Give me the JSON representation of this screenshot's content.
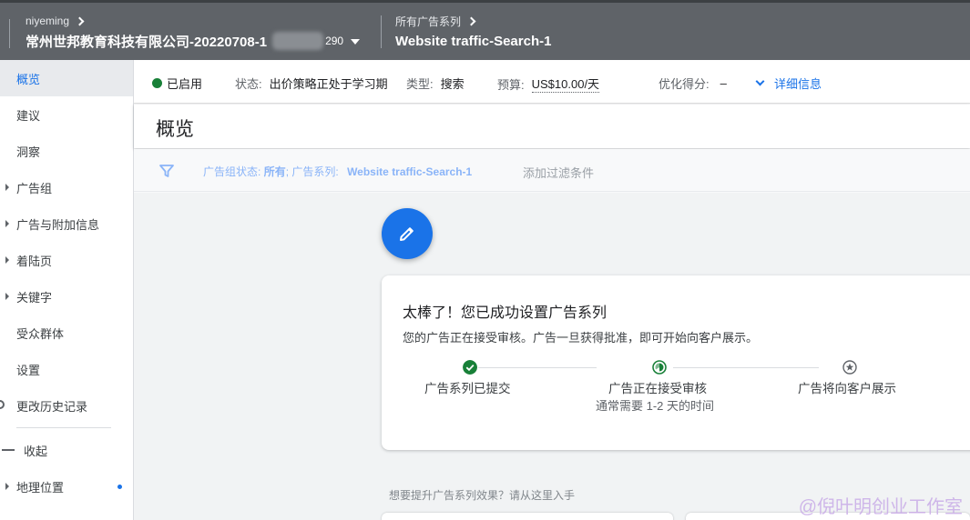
{
  "header": {
    "account_user": "niyeming",
    "account_name": "常州世邦教育科技有限公司-20220708-1",
    "account_id_tail": "290",
    "campaign_scope": "所有广告系列",
    "campaign_name": "Website traffic-Search-1"
  },
  "sidebar": {
    "items": [
      {
        "label": "概览",
        "expandable": false
      },
      {
        "label": "建议",
        "expandable": false
      },
      {
        "label": "洞察",
        "expandable": false
      },
      {
        "label": "广告组",
        "expandable": true
      },
      {
        "label": "广告与附加信息",
        "expandable": true
      },
      {
        "label": "着陆页",
        "expandable": true
      },
      {
        "label": "关键字",
        "expandable": true
      },
      {
        "label": "受众群体",
        "expandable": false
      },
      {
        "label": "设置",
        "expandable": false
      },
      {
        "label": "更改历史记录",
        "expandable": false
      }
    ],
    "collapse_label": "收起",
    "location_label": "地理位置"
  },
  "status_bar": {
    "enabled_label": "已启用",
    "status_label": "状态:",
    "status_value": "出价策略正处于学习期",
    "type_label": "类型:",
    "type_value": "搜索",
    "budget_label": "预算:",
    "budget_value": "US$10.00/天",
    "score_label": "优化得分:",
    "score_value": "–",
    "details_label": "详细信息"
  },
  "page": {
    "title": "概览"
  },
  "filter": {
    "adgroup_status_label": "广告组状态:",
    "adgroup_status_value": "所有",
    "campaign_label": "广告系列:",
    "campaign_value": "Website traffic-Search-1",
    "add_filter": "添加过滤条件"
  },
  "success_card": {
    "title": "太棒了！您已成功设置广告系列",
    "subtitle": "您的广告正在接受审核。广告一旦获得批准，即可开始向客户展示。",
    "steps": [
      {
        "label": "广告系列已提交",
        "state": "done",
        "icon": "check-icon"
      },
      {
        "label": "广告正在接受审核",
        "state": "in-progress",
        "icon": "progress-icon",
        "note": "通常需要 1-2 天的时间"
      },
      {
        "label": "广告将向客户展示",
        "state": "pending",
        "icon": "star-icon"
      }
    ]
  },
  "hint": "想要提升广告系列效果？请从这里入手",
  "watermark": "@倪叶明创业工作室",
  "colors": {
    "header_bg": "#5f6368",
    "accent": "#1a73e8",
    "success": "#188038"
  }
}
